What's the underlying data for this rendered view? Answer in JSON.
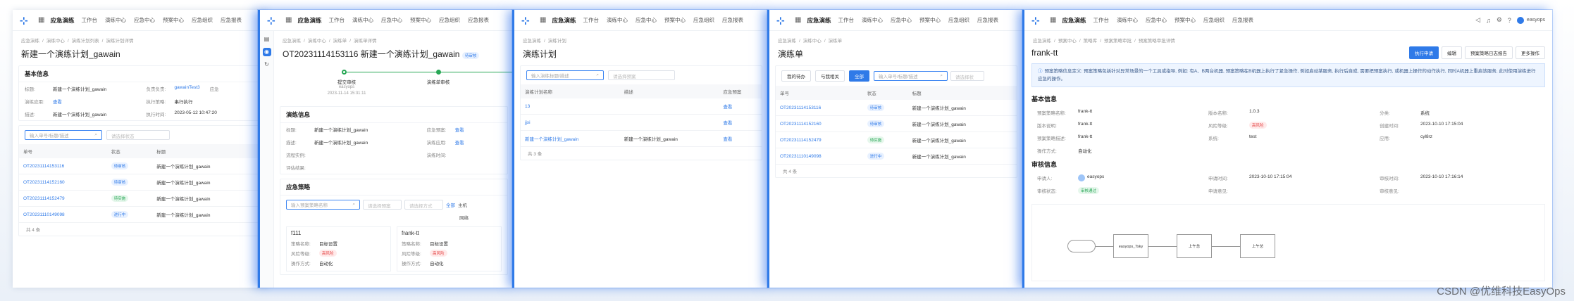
{
  "nav": {
    "app_title": "应急演练",
    "items": [
      "工作台",
      "演练中心",
      "应急中心",
      "预案中心",
      "应急组织",
      "应急报表"
    ]
  },
  "p1": {
    "breadcrumb": [
      "应急演练",
      "/",
      "演练中心",
      "/",
      "演练计划列表",
      "/",
      "演练计划详情"
    ],
    "title": "新建一个演练计划_gawain",
    "basic_title": "基本信息",
    "fields": [
      {
        "k": "标题:",
        "v": "新建一个演练计划_gawain"
      },
      {
        "k": "演练应用:",
        "v": "查看"
      },
      {
        "k": "描述:",
        "v": "新建一个演练计划_gawain"
      }
    ],
    "fields2": [
      {
        "k": "负责负责:",
        "v": "gawainTest3"
      },
      {
        "k": "执行策略:",
        "v": "串行执行"
      },
      {
        "k": "执行时间:",
        "v": "2023-05-12 10:47:20"
      }
    ],
    "extra_label": "应急",
    "search_placeholder": "输入单号/标题/描述",
    "select_placeholder": "请选择状态",
    "columns": [
      "单号",
      "状态",
      "标题"
    ],
    "rows": [
      {
        "id": "OT20231114153116",
        "status": "待审核",
        "title": "新建一个演练计划_gawain"
      },
      {
        "id": "OT20231114152160",
        "status": "待审核",
        "title": "新建一个演练计划_gawain"
      },
      {
        "id": "OT20231114152479",
        "status": "待实施",
        "title": "新建一个演练计划_gawain"
      },
      {
        "id": "OT20231110149098",
        "status": "进行中",
        "title": "新建一个演练计划_gawain"
      }
    ],
    "total": "共 4 条"
  },
  "p2": {
    "breadcrumb": [
      "应急演练",
      "/",
      "演练中心",
      "/",
      "演练单",
      "/",
      "演练单详情"
    ],
    "title": "OT20231114153116 新建一个演练计划_gawain",
    "badge": "待审核",
    "step_label": "提交审核",
    "step_user": "easyops",
    "step_time": "2023-11-14 15:31:11",
    "step2_label": "演练单审核",
    "info_title": "演练信息",
    "info": [
      {
        "k": "标题:",
        "v": "新建一个演练计划_gawain"
      },
      {
        "k": "描述:",
        "v": "新建一个演练计划_gawain"
      },
      {
        "k": "流程实例:",
        "v": ""
      },
      {
        "k": "评估结果:",
        "v": ""
      }
    ],
    "info2": [
      {
        "k": "应急预案:",
        "v": "查看"
      },
      {
        "k": "演练应用:",
        "v": "查看"
      },
      {
        "k": "演练时间:",
        "v": ""
      }
    ],
    "strategy_title": "应急策略",
    "search_placeholder": "输入预案策略名称",
    "select1": "请选择预案",
    "select2": "请选择方式",
    "tabs": [
      "全部",
      "主机"
    ],
    "tab_extra": "网络",
    "card1_title": "f111",
    "card2_title": "frank-tt",
    "card_rows": [
      {
        "k": "策略名称:",
        "v": "目标设置"
      },
      {
        "k": "风险等级:",
        "v": "高风险"
      },
      {
        "k": "操作方式:",
        "v": "自动化"
      }
    ]
  },
  "p3": {
    "breadcrumb": [
      "应急演练",
      "/",
      "演练计划"
    ],
    "title": "演练计划",
    "search_placeholder": "输入演练标题/描述",
    "select_placeholder": "请选择预案",
    "columns": [
      "演练计划名称",
      "描述",
      "应急预案"
    ],
    "rows": [
      {
        "name": "13",
        "desc": "",
        "plan": "查看"
      },
      {
        "name": "jjxi",
        "desc": "",
        "plan": "查看"
      },
      {
        "name": "新建一个演练计划_gawain",
        "desc": "新建一个演练计划_gawain",
        "plan": "查看"
      }
    ],
    "total": "共 3 条"
  },
  "p4": {
    "breadcrumb": [
      "应急演练",
      "/",
      "演练中心",
      "/",
      "演练单"
    ],
    "title": "演练单",
    "filters": [
      "我的待办",
      "与我相关",
      "全部"
    ],
    "search_placeholder": "输入单号/标题/描述",
    "select_placeholder": "请选择状",
    "columns": [
      "单号",
      "状态",
      "标题"
    ],
    "rows": [
      {
        "id": "OT20231114153116",
        "status": "待审核",
        "title": "新建一个演练计划_gawain"
      },
      {
        "id": "OT20231114152160",
        "status": "待审核",
        "title": "新建一个演练计划_gawain"
      },
      {
        "id": "OT20231114152479",
        "status": "待实施",
        "title": "新建一个演练计划_gawain"
      },
      {
        "id": "OT20231110149098",
        "status": "进行中",
        "title": "新建一个演练计划_gawain"
      }
    ],
    "total": "共 4 条"
  },
  "p5": {
    "breadcrumb": [
      "应急演练",
      "/",
      "预案中心",
      "/",
      "策略库",
      "/",
      "预案策略审批",
      "/",
      "预案策略审批详情"
    ],
    "title": "frank-tt",
    "buttons": {
      "primary": "执行申请",
      "edit": "编辑",
      "report": "预案策略日志报告",
      "more": "更多操作"
    },
    "notice": "预案策略信息定义: 预案策略包括针对异常场景的一个工具或指导, 例如: 有A、B两台机器, 预案策略在B机器上执行了紧急操作, 例如启动某服务, 执行后自成, 需要把预案执行, 或机器上操作的动作执行, 同时A机器上重启该服务, 此时使用演练进行应急的操作。",
    "basic_title": "基本信息",
    "basic": [
      {
        "k": "预案策略名称:",
        "v": "frank-tt"
      },
      {
        "k": "版本名称:",
        "v": "1.0.3"
      },
      {
        "k": "分类:",
        "v": "系统"
      },
      {
        "k": "版本说明:",
        "v": "frank-tt"
      },
      {
        "k": "风险等级:",
        "v": "高风险"
      },
      {
        "k": "创建时间:",
        "v": "2023-10-10 17:15:04"
      },
      {
        "k": "预案策略描述:",
        "v": "frank-tt"
      },
      {
        "k": "系统:",
        "v": "test"
      },
      {
        "k": "应用:",
        "v": "cyl8rz"
      },
      {
        "k": "操作方式:",
        "v": "自动化"
      },
      {
        "k": "",
        "v": ""
      },
      {
        "k": "",
        "v": ""
      }
    ],
    "audit_title": "审核信息",
    "audit": [
      {
        "k": "申请人:",
        "v": "easyops"
      },
      {
        "k": "申请时间:",
        "v": "2023-10-10 17:15:04"
      },
      {
        "k": "审核时间:",
        "v": "2023-10-10 17:16:14"
      },
      {
        "k": "审核状态:",
        "v": "审核通过"
      },
      {
        "k": "申请意见:",
        "v": ""
      },
      {
        "k": "审核意见:",
        "v": ""
      }
    ],
    "flow": {
      "node1": "easyops_Tsky",
      "node2": "上午总",
      "node3": "上午总"
    },
    "watermark": "CSDN @优维科技EasyOps"
  },
  "colors": {
    "primary": "#2f7ae8",
    "shadow": "#2f7ae8"
  }
}
